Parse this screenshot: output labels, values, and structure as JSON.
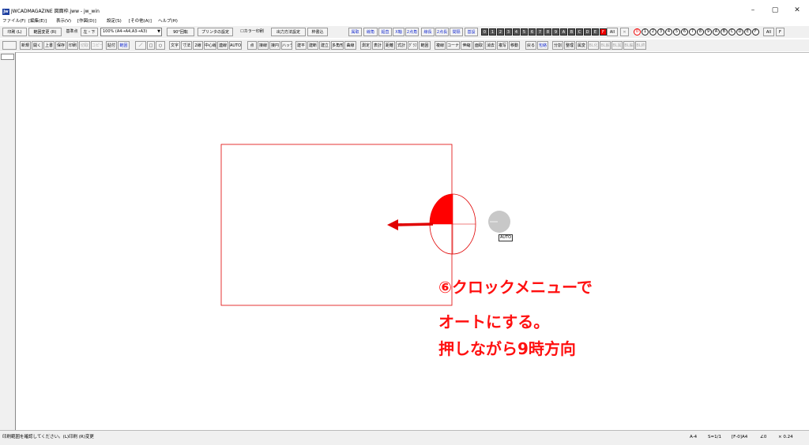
{
  "window": {
    "title": "JWCADMAGAZINE 図面枠.jww - jw_win",
    "icon_label": "jw",
    "controls": {
      "minimize": "–",
      "maximize": "▢",
      "close": "✕"
    }
  },
  "menubar": {
    "items": [
      "ファイル(F)",
      "[編集(E)]",
      "表示(V)",
      "[作図(D)]",
      "設定(S)",
      "[その他(A)]",
      "ヘルプ(H)"
    ]
  },
  "toolbar1": {
    "print_label": "印刷 (L)",
    "range_change_label": "範囲変更 (R)",
    "base_point_label": "基準点",
    "base_point_value": "左・下",
    "scale_select": "100% (A4→A4,A3→A3)",
    "rotate_label": "90°回転",
    "printer_settings_label": "プリンタの設定",
    "color_print_label": "カラー印刷",
    "output_method_label": "出力方法設定",
    "frame_write_label": "枠書込",
    "layer_tools": [
      "属取",
      "線角",
      "鉛直",
      "X軸",
      "2点角",
      "線長",
      "2点長",
      "間隔",
      "基設"
    ],
    "layer_numbers": [
      "0",
      "1",
      "2",
      "3",
      "4",
      "5",
      "6",
      "7",
      "8",
      "9",
      "A",
      "B",
      "C",
      "D",
      "E",
      "F"
    ],
    "all_label": "All",
    "group_numbers": [
      "0",
      "1",
      "2",
      "3",
      "4",
      "5",
      "6",
      "7",
      "8",
      "9",
      "A",
      "B",
      "C",
      "D",
      "E",
      "F"
    ],
    "all2_label": "All",
    "f_label": "F"
  },
  "toolbar2": {
    "buttons": [
      "新規",
      "開く",
      "上書",
      "保存",
      "印刷",
      "切取",
      "コピー",
      "貼付",
      "範囲",
      "／",
      "□",
      "○",
      "文字",
      "寸法",
      "2線",
      "中心線",
      "連線",
      "AUTO",
      "点",
      "接線",
      "接円",
      "ハッチ",
      "建平",
      "建断",
      "建立",
      "多角形",
      "曲線",
      "測定",
      "表計",
      "距離",
      "式計",
      "ｸﾞﾗﾌ",
      "範囲",
      "複線",
      "コーナー",
      "伸縮",
      "面取",
      "消去",
      "複写",
      "移動",
      "戻る",
      "包絡",
      "分割",
      "整理",
      "属変",
      "BL化",
      "BL解",
      "BL属",
      "BL編",
      "BL終"
    ]
  },
  "statusbar": {
    "message": "印刷範囲を確認してください。(L)印刷 (R)変更",
    "paper": "A-4",
    "scale": "S=1/1",
    "layer": "[F-0]A4",
    "angle": "∠0",
    "zoom": "× 0.24"
  },
  "canvas": {
    "auto_label": "AUTO",
    "annotation_lines": [
      "⑥クロックメニューで",
      "オートにする。",
      "押しながら9時方向"
    ],
    "colors": {
      "frame": "#e00000",
      "annotation": "#ff1010",
      "gray_circle": "#c8c8c8"
    }
  }
}
